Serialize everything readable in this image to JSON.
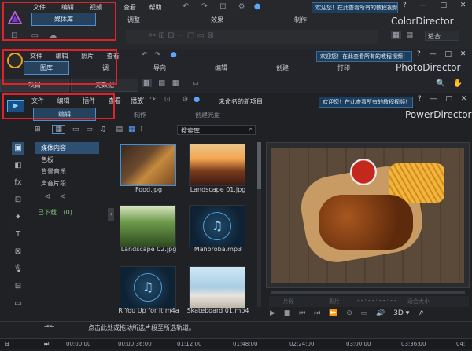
{
  "colordirector": {
    "app_name": "ColorDirector",
    "menu": [
      "文件",
      "编辑",
      "视频",
      "查看",
      "帮助"
    ],
    "library_tab": "媒体库",
    "mode_tabs": [
      "调整",
      "效果",
      "制作"
    ],
    "notice": "欢迎您！在此查看所有的教程视频！",
    "fit_label": "适合"
  },
  "photodirector": {
    "app_name": "PhotoDirector",
    "menu": [
      "文件",
      "编辑",
      "照片",
      "查看"
    ],
    "library_tab": "图库",
    "mode_tabs": [
      "导向",
      "编辑",
      "创建",
      "打印"
    ],
    "notice": "欢迎您！在此查看所有的教程视频！",
    "sub_tabs": [
      "项目",
      "元数据"
    ],
    "adjust_tab": "调"
  },
  "powerdirector": {
    "app_name": "PowerDirector",
    "menu": [
      "文件",
      "编辑",
      "插件",
      "查看"
    ],
    "menu_extra": "播放",
    "project_name": "未命名的新项目",
    "edit_tab": "编辑",
    "other_tabs": [
      "制作",
      "创建光盘"
    ],
    "notice": "欢迎您！在此查看所有的教程视频！",
    "search_placeholder": "搜索库",
    "tree": [
      "媒体内容",
      "色板",
      "背景音乐",
      "声音片段"
    ],
    "downloaded": "已下载",
    "downloaded_count": "(0)",
    "media": [
      {
        "label": "Food.jpg",
        "kind": "food"
      },
      {
        "label": "Landscape 01.jpg",
        "kind": "canyon"
      },
      {
        "label": "Landscape 02.jpg",
        "kind": "forest"
      },
      {
        "label": "Mahoroba.mp3",
        "kind": "audio"
      },
      {
        "label": "R You Up for It.m4a",
        "kind": "audio"
      },
      {
        "label": "Skateboard 01.mp4",
        "kind": "skate"
      }
    ],
    "timeline_hint": "点击此处或拖动所选片段至所选轨道。",
    "preview_mode_a": "片段",
    "preview_mode_b": "影片",
    "timecode": "- - : - - : - - : - -",
    "quality_label": "适合大小",
    "view_3d": "3D",
    "ruler": [
      "00:00:00",
      "00:00:36:00",
      "01:12:00",
      "01:48:00",
      "02:24:00",
      "03:00:00",
      "03:36:00",
      "04:"
    ]
  }
}
